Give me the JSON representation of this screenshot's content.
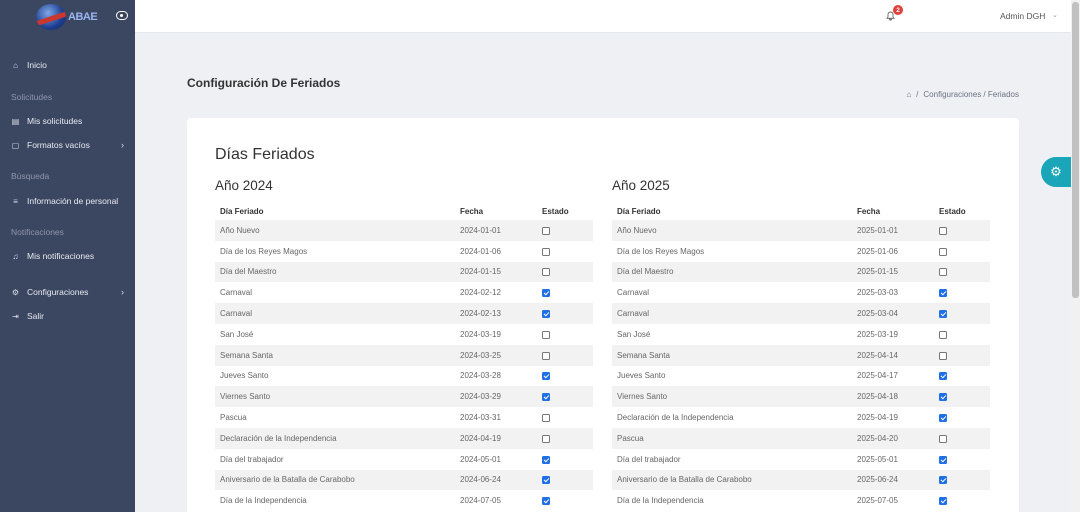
{
  "brand": {
    "logo_text": "ABAE"
  },
  "sidebar": {
    "items": [
      {
        "type": "item",
        "label": "Inicio",
        "icon": "home-icon"
      },
      {
        "type": "section",
        "label": "Solicitudes"
      },
      {
        "type": "item",
        "label": "Mis solicitudes",
        "icon": "document-icon"
      },
      {
        "type": "item",
        "label": "Formatos vacíos",
        "icon": "file-icon",
        "chevron": true
      },
      {
        "type": "section",
        "label": "Búsqueda"
      },
      {
        "type": "item",
        "label": "Información de personal",
        "icon": "list-icon"
      },
      {
        "type": "section",
        "label": "Notificaciones"
      },
      {
        "type": "item",
        "label": "Mis notificaciones",
        "icon": "bell-icon"
      },
      {
        "type": "item",
        "label": "Configuraciones",
        "icon": "gear-icon",
        "chevron": true
      },
      {
        "type": "item",
        "label": "Salir",
        "icon": "logout-icon"
      }
    ]
  },
  "topbar": {
    "notification_count": "2",
    "user_name": "Admin DGH"
  },
  "header": {
    "title": "Configuración De Feriados",
    "breadcrumb": "Configuraciones / Feriados"
  },
  "card": {
    "title": "Días Feriados",
    "col_name": "Día Feriado",
    "col_date": "Fecha",
    "col_status": "Estado",
    "years": [
      {
        "title": "Año 2024",
        "rows": [
          {
            "name": "Año Nuevo",
            "date": "2024-01-01",
            "active": false
          },
          {
            "name": "Día de los Reyes Magos",
            "date": "2024-01-06",
            "active": false
          },
          {
            "name": "Día del Maestro",
            "date": "2024-01-15",
            "active": false
          },
          {
            "name": "Carnaval",
            "date": "2024-02-12",
            "active": true
          },
          {
            "name": "Carnaval",
            "date": "2024-02-13",
            "active": true
          },
          {
            "name": "San José",
            "date": "2024-03-19",
            "active": false
          },
          {
            "name": "Semana Santa",
            "date": "2024-03-25",
            "active": false
          },
          {
            "name": "Jueves Santo",
            "date": "2024-03-28",
            "active": true
          },
          {
            "name": "Viernes Santo",
            "date": "2024-03-29",
            "active": true
          },
          {
            "name": "Pascua",
            "date": "2024-03-31",
            "active": false
          },
          {
            "name": "Declaración de la Independencia",
            "date": "2024-04-19",
            "active": false
          },
          {
            "name": "Día del trabajador",
            "date": "2024-05-01",
            "active": true
          },
          {
            "name": "Aniversario de la Batalla de Carabobo",
            "date": "2024-06-24",
            "active": true
          },
          {
            "name": "Día de la Independencia",
            "date": "2024-07-05",
            "active": true
          }
        ]
      },
      {
        "title": "Año 2025",
        "rows": [
          {
            "name": "Año Nuevo",
            "date": "2025-01-01",
            "active": false
          },
          {
            "name": "Día de los Reyes Magos",
            "date": "2025-01-06",
            "active": false
          },
          {
            "name": "Día del Maestro",
            "date": "2025-01-15",
            "active": false
          },
          {
            "name": "Carnaval",
            "date": "2025-03-03",
            "active": true
          },
          {
            "name": "Carnaval",
            "date": "2025-03-04",
            "active": true
          },
          {
            "name": "San José",
            "date": "2025-03-19",
            "active": false
          },
          {
            "name": "Semana Santa",
            "date": "2025-04-14",
            "active": false
          },
          {
            "name": "Jueves Santo",
            "date": "2025-04-17",
            "active": true
          },
          {
            "name": "Viernes Santo",
            "date": "2025-04-18",
            "active": true
          },
          {
            "name": "Declaración de la Independencia",
            "date": "2025-04-19",
            "active": true
          },
          {
            "name": "Pascua",
            "date": "2025-04-20",
            "active": false
          },
          {
            "name": "Día del trabajador",
            "date": "2025-05-01",
            "active": true
          },
          {
            "name": "Aniversario de la Batalla de Carabobo",
            "date": "2025-06-24",
            "active": true
          },
          {
            "name": "Día de la Independencia",
            "date": "2025-07-05",
            "active": true
          }
        ]
      }
    ]
  }
}
